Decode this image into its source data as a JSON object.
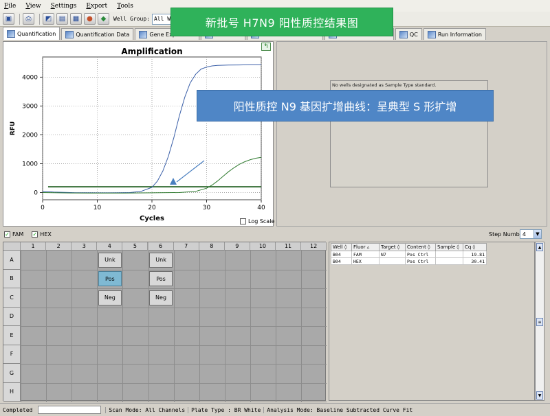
{
  "menu": [
    "File",
    "View",
    "Settings",
    "Export",
    "Tools"
  ],
  "toolbar": {
    "well_group_label": "Well Group:",
    "well_group_value": "All Wells"
  },
  "banner": "新批号 H7N9 阳性质控结果图",
  "tabs": [
    "Quantification",
    "Quantification Data",
    "Gene Expression",
    "End Point",
    "Allelic Discrimination",
    "Custom Data View",
    "QC",
    "Run Information"
  ],
  "callout": "阳性质控 N9 基因扩增曲线：呈典型 S 形扩增",
  "chart_data": {
    "type": "line",
    "title": "Amplification",
    "xlabel": "Cycles",
    "ylabel": "RFU",
    "xlim": [
      0,
      40
    ],
    "ylim": [
      -250,
      4700
    ],
    "xticks": [
      0,
      10,
      20,
      30,
      40
    ],
    "yticks": [
      0,
      1000,
      2000,
      3000,
      4000
    ],
    "threshold": 200,
    "series": [
      {
        "color": "#3a5fa8",
        "cq": 19.81,
        "plateau": 4430,
        "slope": 0.52,
        "x": [
          0,
          2,
          4,
          6,
          8,
          10,
          12,
          14,
          16,
          18,
          20,
          21,
          22,
          23,
          24,
          25,
          26,
          27,
          28,
          29,
          30,
          31,
          32,
          34,
          36,
          38,
          40
        ],
        "y": [
          45,
          20,
          5,
          -5,
          -8,
          -10,
          -10,
          -8,
          0,
          40,
          180,
          400,
          750,
          1250,
          1900,
          2650,
          3300,
          3800,
          4100,
          4280,
          4350,
          4390,
          4410,
          4420,
          4425,
          4430,
          4430
        ]
      },
      {
        "color": "#2f7a2f",
        "cq": 30.41,
        "x": [
          0,
          5,
          10,
          15,
          20,
          25,
          28,
          30,
          31,
          32,
          33,
          34,
          35,
          36,
          37,
          38,
          39,
          40
        ],
        "y": [
          0,
          -15,
          -20,
          -18,
          -10,
          0,
          40,
          150,
          260,
          400,
          560,
          720,
          860,
          980,
          1070,
          1140,
          1190,
          1220
        ]
      }
    ]
  },
  "log_scale_label": "Log Scale",
  "sample_type_message": "No wells designated as Sample Type standard.",
  "fluors": [
    {
      "label": "FAM",
      "checked": true
    },
    {
      "label": "HEX",
      "checked": true
    }
  ],
  "step": {
    "label": "Step Number:",
    "value": "4"
  },
  "plate": {
    "cols": [
      "1",
      "2",
      "3",
      "4",
      "5",
      "6",
      "7",
      "8",
      "9",
      "10",
      "11",
      "12"
    ],
    "rows": [
      "A",
      "B",
      "C",
      "D",
      "E",
      "F",
      "G",
      "H"
    ],
    "wells": [
      {
        "row": "A",
        "col": "4",
        "label": "Unk",
        "selected": false
      },
      {
        "row": "A",
        "col": "6",
        "label": "Unk",
        "selected": false
      },
      {
        "row": "B",
        "col": "4",
        "label": "Pos",
        "selected": true
      },
      {
        "row": "B",
        "col": "6",
        "label": "Pos",
        "selected": false
      },
      {
        "row": "C",
        "col": "4",
        "label": "Neg",
        "selected": false
      },
      {
        "row": "C",
        "col": "6",
        "label": "Neg",
        "selected": false
      }
    ]
  },
  "table": {
    "headers": [
      "Well",
      "Fluor",
      "Target",
      "Content",
      "Sample",
      "Cq"
    ],
    "rows": [
      [
        "B04",
        "FAM",
        "N7",
        "Pos Ctrl",
        "",
        "19.81"
      ],
      [
        "B04",
        "HEX",
        "",
        "Pos Ctrl",
        "",
        "30.41"
      ]
    ]
  },
  "status": {
    "state": "Completed",
    "scan_mode": "Scan Mode: All Channels",
    "plate_type": "Plate Type : BR White",
    "analysis_mode": "Analysis Mode: Baseline Subtracted Curve Fit"
  }
}
